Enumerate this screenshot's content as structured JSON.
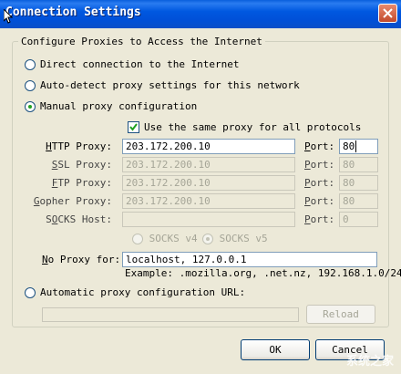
{
  "window": {
    "title": "Connection Settings"
  },
  "group": {
    "label": "Configure Proxies to Access the Internet"
  },
  "options": {
    "direct": "Direct connection to the Internet",
    "auto_detect": "Auto-detect proxy settings for this network",
    "manual": "Manual proxy configuration",
    "auto_url": "Automatic proxy configuration URL:"
  },
  "same_proxy": {
    "label": "Use the same proxy for all protocols",
    "checked": true
  },
  "proxies": {
    "http": {
      "label_pre": "",
      "label_key": "H",
      "label_post": "TTP Proxy:",
      "value": "203.172.200.10",
      "port": "80"
    },
    "ssl": {
      "label_pre": "",
      "label_key": "S",
      "label_post": "SL Proxy:",
      "value": "203.172.200.10",
      "port": "80"
    },
    "ftp": {
      "label_pre": "",
      "label_key": "F",
      "label_post": "TP Proxy:",
      "value": "203.172.200.10",
      "port": "80"
    },
    "gopher": {
      "label_pre": "",
      "label_key": "G",
      "label_post": "opher Proxy:",
      "value": "203.172.200.10",
      "port": "80"
    },
    "socks": {
      "label_pre": "S",
      "label_key": "O",
      "label_post": "CKS Host:",
      "value": "",
      "port": "0"
    }
  },
  "port_label": {
    "key": "P",
    "rest": "ort:"
  },
  "socks_versions": {
    "v4": "SOCKS v4",
    "v5": "SOCKS v5",
    "selected": "v5"
  },
  "no_proxy": {
    "label_key": "N",
    "label_rest": "o Proxy for:",
    "value": "localhost, 127.0.0.1"
  },
  "example": "Example: .mozilla.org, .net.nz, 192.168.1.0/24",
  "auto_url_value": "",
  "buttons": {
    "reload": "Reload",
    "ok": "OK",
    "cancel": "Cancel"
  },
  "watermark": "系统之家",
  "colors": {
    "title_bar": "#0054e3",
    "dialog_bg": "#ece9d8",
    "checked_dot": "#21a121"
  }
}
